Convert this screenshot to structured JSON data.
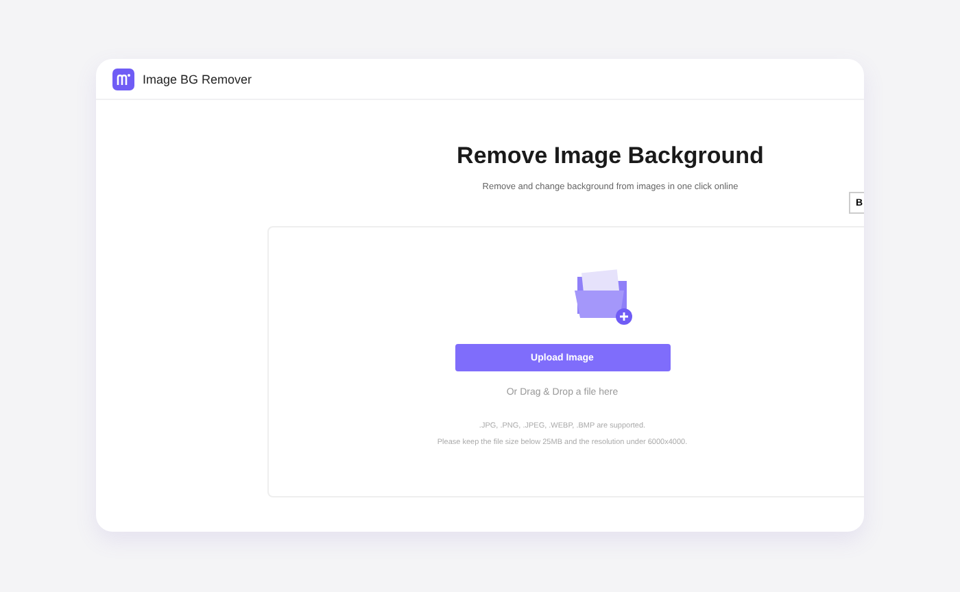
{
  "app": {
    "title": "Image BG Remover"
  },
  "hero": {
    "title": "Remove Image Background",
    "subtitle": "Remove and change background from images in one click online",
    "side_button": "B"
  },
  "upload": {
    "button": "Upload Image",
    "hint": "Or Drag & Drop a file here",
    "formats": ".JPG, .PNG, .JPEG, .WEBP, .BMP are supported.",
    "limits": "Please keep the file size below 25MB and the resolution under 6000x4000."
  }
}
